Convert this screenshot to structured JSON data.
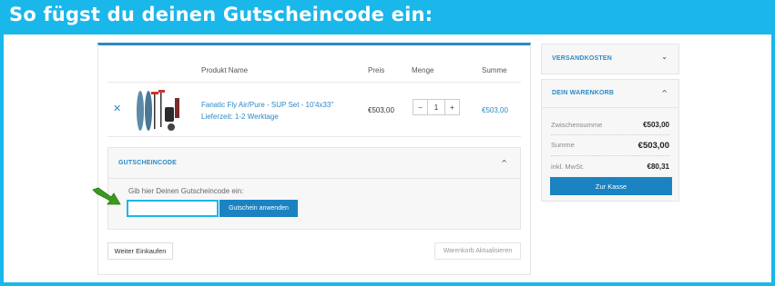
{
  "banner": {
    "title": "So fügst du deinen Gutscheincode ein:"
  },
  "cart": {
    "columns": {
      "product": "Produkt Name",
      "price": "Preis",
      "quantity": "Menge",
      "sum": "Summe"
    },
    "item": {
      "remove_glyph": "✕",
      "name": "Fanatic Fly Air/Pure - SUP Set - 10'4x33\"",
      "delivery": "Lieferzeit: 1-2 Werktage",
      "price": "€503,00",
      "qty_minus": "−",
      "quantity": "1",
      "qty_plus": "+",
      "sum": "€503,00"
    },
    "coupon": {
      "title": "GUTSCHEINCODE",
      "chevron": "^",
      "label": "Gib hier Deinen Gutscheincode ein:",
      "input_value": "",
      "apply_label": "Gutschein anwenden"
    },
    "continue_label": "Weiter Einkaufen",
    "update_label": "Warenkorb Aktualisieren"
  },
  "sidebar": {
    "shipping": {
      "title": "VERSANDKOSTEN",
      "chevron": "⌄"
    },
    "cart": {
      "title": "DEIN WARENKORB",
      "chevron": "^",
      "subtotal_label": "Zwischensumme",
      "subtotal_value": "€503,00",
      "total_label": "Summe",
      "total_value": "€503,00",
      "tax_label": "inkl. MwSt.",
      "tax_value": "€80,31",
      "checkout_label": "Zur Kasse"
    }
  },
  "colors": {
    "accent": "#1ab7ea",
    "link": "#2a8ac5",
    "button": "#1b83c2",
    "arrow": "#3a9a1f"
  },
  "icons": {
    "remove": "close-icon",
    "arrow": "arrow-pointer-icon",
    "chevron": "chevron-icon"
  }
}
